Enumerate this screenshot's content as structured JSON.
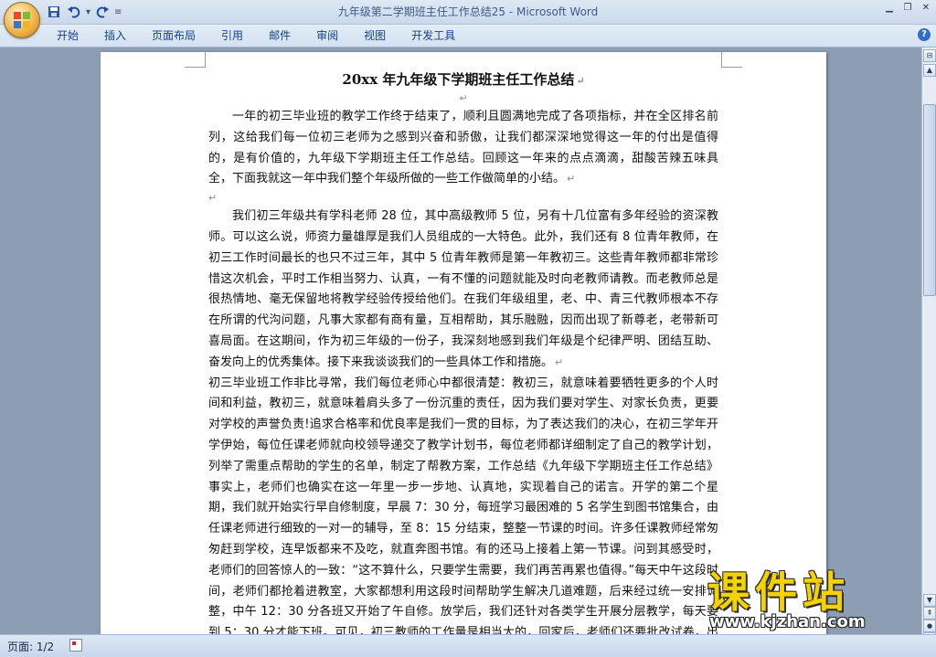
{
  "window": {
    "doc_name": "九年级第二学期班主任工作总结25",
    "separator": " - ",
    "app_name": "Microsoft Word"
  },
  "qat": {
    "save_icon": "save-icon",
    "undo_icon": "undo-icon",
    "redo_icon": "redo-icon",
    "more_glyph": "▾"
  },
  "ribbon": {
    "tabs": [
      "开始",
      "插入",
      "页面布局",
      "引用",
      "邮件",
      "审阅",
      "视图",
      "开发工具"
    ],
    "help_glyph": "?"
  },
  "document": {
    "heading": "20xx 年九年级下学期班主任工作总结",
    "para_mark": "↵",
    "paragraphs": [
      "一年的初三毕业班的教学工作终于结束了，顺利且圆满地完成了各项指标，并在全区排名前列，这给我们每一位初三老师为之感到兴奋和骄傲，让我们都深深地觉得这一年的付出是值得的，是有价值的，九年级下学期班主任工作总结。回顾这一年来的点点滴滴，甜酸苦辣五味具全，下面我就这一年中我们整个年级所做的一些工作做简单的小结。",
      "我们初三年级共有学科老师 28 位，其中高级教师 5 位，另有十几位富有多年经验的资深教师。可以这么说，师资力量雄厚是我们人员组成的一大特色。此外，我们还有 8 位青年教师，在初三工作时间最长的也只不过三年，其中 5 位青年教师是第一年教初三。这些青年教师都非常珍惜这次机会，平时工作相当努力、认真，一有不懂的问题就能及时向老教师请教。而老教师总是很热情地、毫无保留地将教学经验传授给他们。在我们年级组里，老、中、青三代教师根本不存在所谓的代沟问题，凡事大家都有商有量，互相帮助，其乐融融，因而出现了新尊老，老带新可喜局面。在这期间，作为初三年级的一份子，我深刻地感到我们年级是个纪律严明、团结互助、奋发向上的优秀集体。接下来我谈谈我们的一些具体工作和措施。",
      "初三毕业班工作非比寻常，我们每位老师心中都很清楚：教初三，就意味着要牺牲更多的个人时间和利益，教初三，就意味着肩头多了一份沉重的责任，因为我们要对学生、对家长负责，更要对学校的声誉负责!追求合格率和优良率是我们一贯的目标，为了表达我们的决心，在初三学年开学伊始，每位任课老师就向校领导递交了教学计划书，每位老师都详细制定了自己的教学计划，列举了需重点帮助的学生的名单，制定了帮教方案，工作总结《九年级下学期班主任工作总结》事实上，老师们也确实在这一年里一步一步地、认真地，实现着自己的诺言。开学的第二个星期，我们就开始实行早自修制度，早晨 7：30 分，每班学习最困难的 5 名学生到图书馆集合，由任课老师进行细致的一对一的辅导，至 8：15 分结束，整整一节课的时间。许多任课教师经常匆匆赶到学校，连早饭都来不及吃，就直奔图书馆。有的还马上接着上第一节课。问到其感受时，老师们的回答惊人的一致：“这不算什么，只要学生需要，我们再苦再累也值得。”每天中午这段时间，老师们都抢着进教室，大家都想利用这段时间帮助学生解决几道难题，后来经过统一安排调整，中午 12：30 分各班又开始了午自修。放学后，我们还针对各类学生开展分层教学，每天要到 5：30 分才能下班。可见，初三教师的工作量是相当大的，回家后，老师们还要批改试卷，出试题，经常要熬到深夜才能休息。家务事是更顾不上了。"
    ]
  },
  "scrollbar": {
    "ruler_glyph": "⊟",
    "up": "▲",
    "down": "▼",
    "prev": "⇞",
    "select": "●",
    "next": "⇟"
  },
  "status": {
    "page_count": "页面: 1/2"
  },
  "watermark": {
    "text": "课件站",
    "url": "www.kjzhan.com"
  },
  "colors": {
    "accent": "#15428b",
    "page_bg": "#ffffff",
    "workspace_bg": "#8d9db3",
    "watermark": "#f4d200"
  }
}
